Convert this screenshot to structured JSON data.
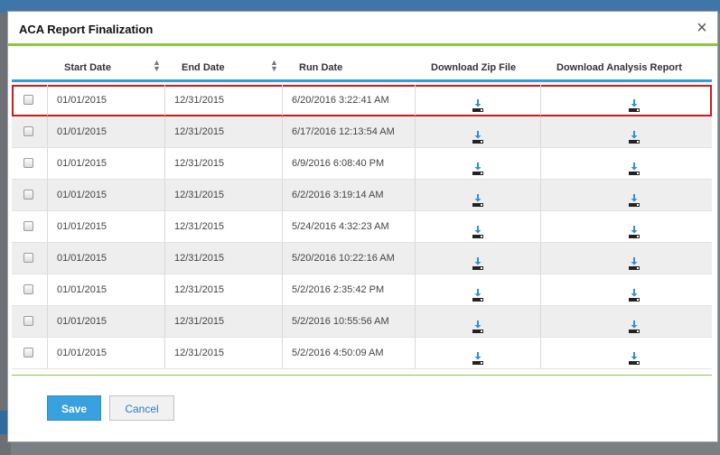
{
  "modal": {
    "title": "ACA Report Finalization",
    "close_label": "×"
  },
  "table": {
    "headers": {
      "start_date": "Start Date",
      "end_date": "End Date",
      "run_date": "Run Date",
      "download_zip": "Download Zip File",
      "download_analysis": "Download Analysis Report"
    },
    "rows": [
      {
        "start": "01/01/2015",
        "end": "12/31/2015",
        "run": "6/20/2016 3:22:41 AM",
        "checked": false,
        "highlighted": true
      },
      {
        "start": "01/01/2015",
        "end": "12/31/2015",
        "run": "6/17/2016 12:13:54 AM",
        "checked": false
      },
      {
        "start": "01/01/2015",
        "end": "12/31/2015",
        "run": "6/9/2016 6:08:40 PM",
        "checked": false
      },
      {
        "start": "01/01/2015",
        "end": "12/31/2015",
        "run": "6/2/2016 3:19:14 AM",
        "checked": false
      },
      {
        "start": "01/01/2015",
        "end": "12/31/2015",
        "run": "5/24/2016 4:32:23 AM",
        "checked": false
      },
      {
        "start": "01/01/2015",
        "end": "12/31/2015",
        "run": "5/20/2016 10:22:16 AM",
        "checked": false
      },
      {
        "start": "01/01/2015",
        "end": "12/31/2015",
        "run": "5/2/2016 2:35:42 PM",
        "checked": false
      },
      {
        "start": "01/01/2015",
        "end": "12/31/2015",
        "run": "5/2/2016 10:55:56 AM",
        "checked": false
      },
      {
        "start": "01/01/2015",
        "end": "12/31/2015",
        "run": "5/2/2016 4:50:09 AM",
        "checked": false
      }
    ]
  },
  "buttons": {
    "save": "Save",
    "cancel": "Cancel"
  },
  "icons": {
    "download": "download-icon",
    "sort": "sort-icon",
    "close": "close-icon"
  },
  "colors": {
    "accent_green": "#8dc63f",
    "accent_blue": "#3a9ad9",
    "save_button": "#3aa1e0",
    "highlight_border": "#d0191f"
  }
}
